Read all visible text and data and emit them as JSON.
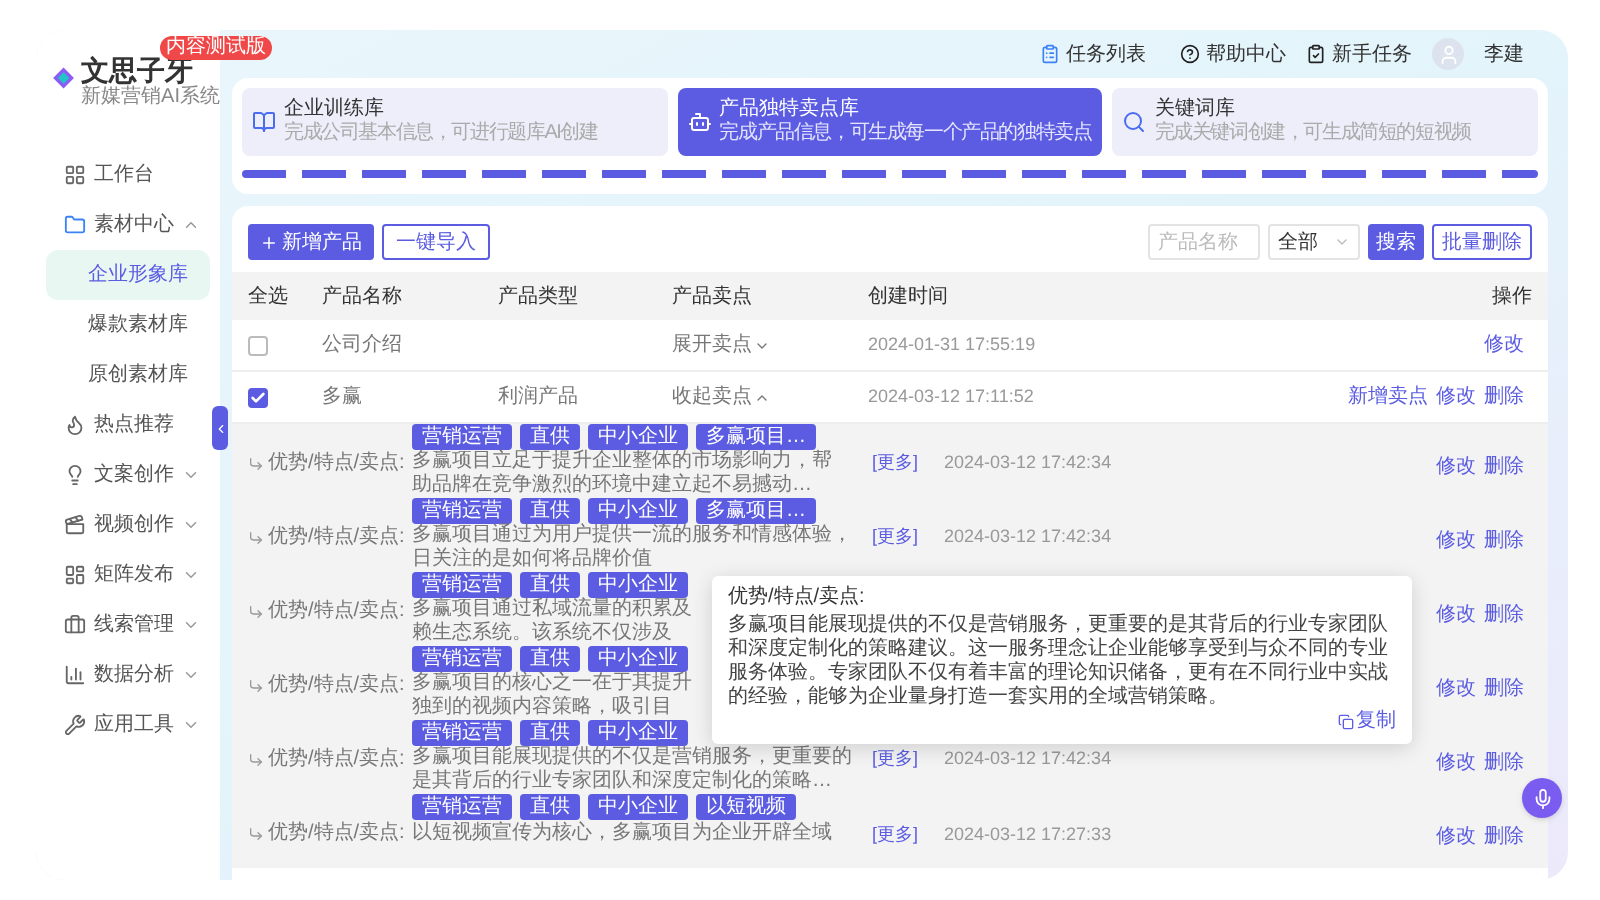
{
  "brand": {
    "name": "文思子牙",
    "subtitle": "新媒营销AI系统",
    "badge": "内容测试版"
  },
  "sidebar": {
    "items": [
      {
        "kind": "link",
        "label": "工作台",
        "selected": false
      },
      {
        "kind": "group",
        "label": "素材中心",
        "selected": false,
        "expanded": true,
        "children": [
          {
            "label": "企业形象库",
            "selected": true
          },
          {
            "label": "爆款素材库",
            "selected": false
          },
          {
            "label": "原创素材库",
            "selected": false
          }
        ]
      },
      {
        "kind": "link",
        "label": "热点推荐",
        "selected": false
      },
      {
        "kind": "group",
        "label": "文案创作",
        "selected": false,
        "expanded": false
      },
      {
        "kind": "group",
        "label": "视频创作",
        "selected": false,
        "expanded": false
      },
      {
        "kind": "group",
        "label": "矩阵发布",
        "selected": false,
        "expanded": false
      },
      {
        "kind": "group",
        "label": "线索管理",
        "selected": false,
        "expanded": false
      },
      {
        "kind": "group",
        "label": "数据分析",
        "selected": false,
        "expanded": false
      },
      {
        "kind": "group",
        "label": "应用工具",
        "selected": false,
        "expanded": false
      }
    ]
  },
  "header": {
    "links": [
      {
        "kind": "pill",
        "label": "任务列表"
      },
      {
        "kind": "plain",
        "label": "帮助中心"
      },
      {
        "kind": "plain",
        "label": "新手任务"
      }
    ],
    "user": {
      "name": "李建"
    }
  },
  "tabs": [
    {
      "title": "企业训练库",
      "subtitle": "完成公司基本信息，可进行题库AI创建",
      "selected": false
    },
    {
      "title": "产品独特卖点库",
      "subtitle": "完成产品信息，可生成每一个产品的独特卖点",
      "selected": true
    },
    {
      "title": "关键词库",
      "subtitle": "完成关键词创建，可生成简短的短视频",
      "selected": false
    }
  ],
  "toolbar": {
    "buttons": [
      {
        "kind": "primary",
        "label": "新增产品"
      },
      {
        "kind": "outline",
        "label": "一键导入"
      }
    ],
    "search": {
      "placeholder": "产品名称"
    },
    "filter": {
      "value": "全部"
    },
    "search_button": "搜索",
    "batch_delete": "批量删除"
  },
  "table": {
    "columns": [
      "全选",
      "产品名称",
      "产品类型",
      "产品卖点",
      "创建时间",
      "操作"
    ],
    "rows": [
      {
        "checked": false,
        "name": "公司介绍",
        "type": "",
        "toggle": {
          "label": "展开卖点",
          "expanded": false
        },
        "created": "2024-01-31 17:55:19",
        "actions": [
          "修改"
        ],
        "features": []
      },
      {
        "checked": true,
        "name": "多赢",
        "type": "利润产品",
        "toggle": {
          "label": "收起卖点",
          "expanded": true
        },
        "created": "2024-03-12 17:11:52",
        "actions": [
          "新增卖点",
          "修改",
          "删除"
        ],
        "features": [
          {
            "label": "优势/特点/卖点:",
            "tags": [
              "营销运营",
              "直供",
              "中小企业",
              "多赢项目…"
            ],
            "lines": [
              "多赢项目立足于提升企业整体的市场影响力，帮",
              "助品牌在竞争激烈的环境中建立起不易撼动…"
            ],
            "more": "[更多]",
            "created": "2024-03-12 17:42:34",
            "actions": [
              "修改",
              "删除"
            ]
          },
          {
            "label": "优势/特点/卖点:",
            "tags": [
              "营销运营",
              "直供",
              "中小企业",
              "多赢项目…"
            ],
            "lines": [
              "多赢项目通过为用户提供一流的服务和情感体验，",
              "日关注的是如何将品牌价值"
            ],
            "more": "[更多]",
            "created": "2024-03-12 17:42:34",
            "actions": [
              "修改",
              "删除"
            ]
          },
          {
            "label": "优势/特点/卖点:",
            "tags": [
              "营销运营",
              "直供",
              "中小企业"
            ],
            "lines": [
              "多赢项目通过私域流量的积累及",
              "赖生态系统。该系统不仅涉及"
            ],
            "actions": [
              "修改",
              "删除"
            ]
          },
          {
            "label": "优势/特点/卖点:",
            "tags": [
              "营销运营",
              "直供",
              "中小企业"
            ],
            "lines": [
              "多赢项目的核心之一在于其提升",
              "独到的视频内容策略，吸引目"
            ],
            "actions": [
              "修改",
              "删除"
            ]
          },
          {
            "label": "优势/特点/卖点:",
            "tags": [
              "营销运营",
              "直供",
              "中小企业"
            ],
            "lines": [
              "多赢项目能展现提供的不仅是营销服务，更重要的",
              "是其背后的行业专家团队和深度定制化的策略…"
            ],
            "more": "[更多]",
            "created": "2024-03-12 17:42:34",
            "actions": [
              "修改",
              "删除"
            ]
          },
          {
            "label": "优势/特点/卖点:",
            "tags": [
              "营销运营",
              "直供",
              "中小企业",
              "以短视频"
            ],
            "lines": [
              "以短视频宣传为核心，多赢项目为企业开辟全域"
            ],
            "more": "[更多]",
            "created": "2024-03-12 17:27:33",
            "actions": [
              "修改",
              "删除"
            ]
          }
        ]
      }
    ]
  },
  "popover": {
    "title": "优势/特点/卖点:",
    "body": "多赢项目能展现提供的不仅是营销服务，更重要的是其背后的行业专家团队和深度定制化的策略建议。这一服务理念让企业能够享受到与众不同的专业服务体验。专家团队不仅有着丰富的理论知识储备，更有在不同行业中实战的经验，能够为企业量身打造一套实用的全域营销策略。",
    "copy": "复制"
  }
}
